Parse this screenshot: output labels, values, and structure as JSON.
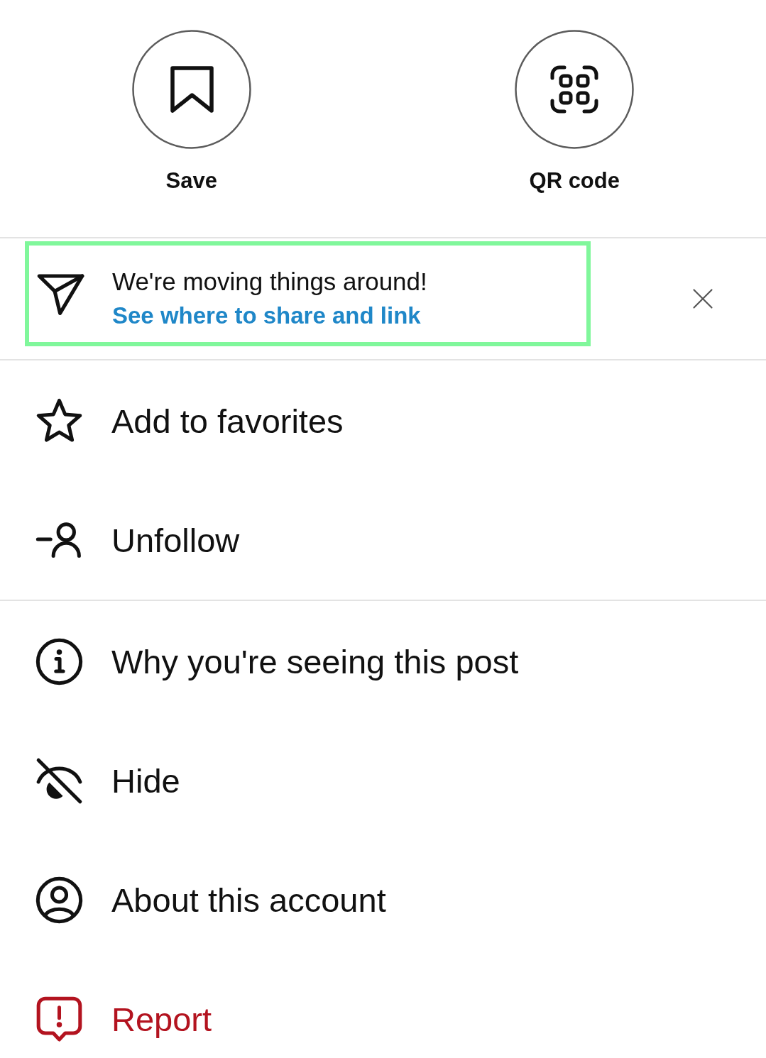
{
  "actions": [
    {
      "label": "Save"
    },
    {
      "label": "QR code"
    }
  ],
  "notice": {
    "message": "We're moving things around!",
    "link": "See where to share and link",
    "highlighted": true
  },
  "menu_groups": [
    {
      "items": [
        {
          "label": "Add to favorites",
          "kind": "default"
        },
        {
          "label": "Unfollow",
          "kind": "default"
        }
      ]
    },
    {
      "items": [
        {
          "label": "Why you're seeing this post",
          "kind": "default"
        },
        {
          "label": "Hide",
          "kind": "default"
        },
        {
          "label": "About this account",
          "kind": "default"
        },
        {
          "label": "Report",
          "kind": "destructive"
        }
      ]
    }
  ]
}
